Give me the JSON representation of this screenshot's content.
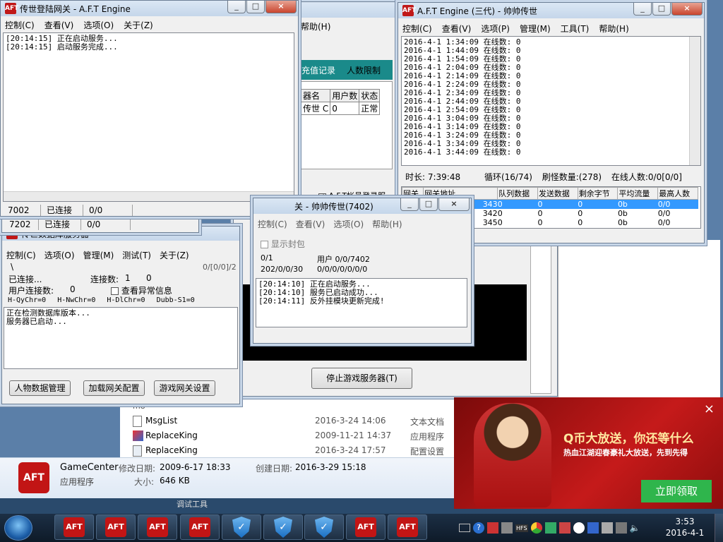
{
  "login_gateway": {
    "title": "传世登陆网关 - A.F.T Engine",
    "menu": [
      "控制(C)",
      "查看(V)",
      "选项(O)",
      "关于(Z)"
    ],
    "log": [
      "[20:14:15] 正在启动服务...",
      "[20:14:15] 启动服务完成..."
    ],
    "status": [
      "7002",
      "已连接",
      "0/0"
    ],
    "status2": [
      "7202",
      "已连接",
      "0/0"
    ]
  },
  "bg_window": {
    "menu_item": "帮助(H)",
    "tabs": [
      "充值记录",
      "人数限制"
    ],
    "table_headers": [
      "器名",
      "用户数",
      "状态"
    ],
    "table_row": [
      "传世 C",
      "0",
      "正常"
    ],
    "checkbox": "A.F.T帐号登录服",
    "stop_button": "停止游戏服务器(T)"
  },
  "engine": {
    "title": "A.F.T Engine (三代) - 帅帅传世",
    "menu": [
      "控制(C)",
      "查看(V)",
      "选项(P)",
      "管理(M)",
      "工具(T)",
      "帮助(H)"
    ],
    "log": [
      "2016-4-1 1:34:09 在线数: 0",
      "2016-4-1 1:44:09 在线数: 0",
      "2016-4-1 1:54:09 在线数: 0",
      "2016-4-1 2:04:09 在线数: 0",
      "2016-4-1 2:14:09 在线数: 0",
      "2016-4-1 2:24:09 在线数: 0",
      "2016-4-1 2:34:09 在线数: 0",
      "2016-4-1 2:44:09 在线数: 0",
      "2016-4-1 2:54:09 在线数: 0",
      "2016-4-1 3:04:09 在线数: 0",
      "2016-4-1 3:14:09 在线数: 0",
      "2016-4-1 3:24:09 在线数: 0",
      "2016-4-1 3:34:09 在线数: 0",
      "2016-4-1 3:44:09 在线数: 0"
    ],
    "info": [
      "时长: 7:39:48",
      "循环(16/74)",
      "刷怪数量:(278)",
      "在线人数:0/0[0/0]"
    ],
    "grid_headers": [
      "网关",
      "网关地址",
      "队列数据",
      "发送数据",
      "剩余字节",
      "平均流量",
      "最高人数"
    ],
    "grid_rows": [
      [
        "",
        "343",
        "0",
        "0",
        "0",
        "0b",
        "0/0"
      ],
      [
        "",
        "342",
        "0",
        "0",
        "0",
        "0b",
        "0/0"
      ],
      [
        "",
        "345",
        "0",
        "0",
        "0",
        "0b",
        "0/0"
      ]
    ]
  },
  "db_server": {
    "title": "传世数据库服务器",
    "menu": [
      "控制(C)",
      "选项(O)",
      "管理(M)",
      "测试(T)",
      "关于(Z)"
    ],
    "path": "\\",
    "counter": "0/[0/0]/2",
    "connected": "已连接...",
    "conn_count_label": "连接数:",
    "conn_count": "1",
    "conn_extra": "0",
    "user_conn_label": "用户连接数:",
    "user_conn": "0",
    "check_label": "查看异常信息",
    "stats": [
      "H-QyChr=0",
      "H-NwChr=0",
      "H-DlChr=0",
      "Dubb-S1=0"
    ],
    "log": [
      "正在检测数据库版本...",
      "服务器已启动..."
    ],
    "buttons": [
      "人物数据管理",
      "加载网关配置",
      "游戏网关设置"
    ]
  },
  "game_gateway": {
    "title": "关 - 帅帅传世(7402)",
    "menu": [
      "控制(C)",
      "查看(V)",
      "选项(O)",
      "帮助(H)"
    ],
    "checkbox": "显示封包",
    "line1_left": "0/1",
    "line1_right": "用户 0/0/7402",
    "line2_left": "202/0/0/30",
    "line2_right": "0/0/0/0/0/0/0",
    "log": [
      "[20:14:10] 正在启动服务...",
      "[20:14:10] 服务已启动成功...",
      "[20:14:11] 反外挂模块更新完成!"
    ]
  },
  "explorer": {
    "files": [
      {
        "name": "MsgList",
        "date": "2016-3-24 14:06",
        "type": "文本文档"
      },
      {
        "name": "ReplaceKing",
        "date": "2009-11-21 14:37",
        "type": "应用程序"
      },
      {
        "name": "ReplaceKing",
        "date": "2016-3-24 17:57",
        "type": "配置设置"
      }
    ],
    "detail_name": "GameCenter",
    "detail_modified_label": "修改日期:",
    "detail_modified": "2009-6-17 18:33",
    "detail_created_label": "创建日期:",
    "detail_created": "2016-3-29 15:18",
    "detail_type": "应用程序",
    "detail_size_label": "大小:",
    "detail_size": "646 KB",
    "bottom_cut": "调试工具"
  },
  "ad": {
    "headline": "Q币大放送，你还等什么",
    "subline": "热血江湖迎春豪礼大放送，先到先得",
    "button": "立即领取"
  },
  "taskbar": {
    "time": "3:53",
    "date": "2016-4-1",
    "tray_text": "HFS"
  }
}
